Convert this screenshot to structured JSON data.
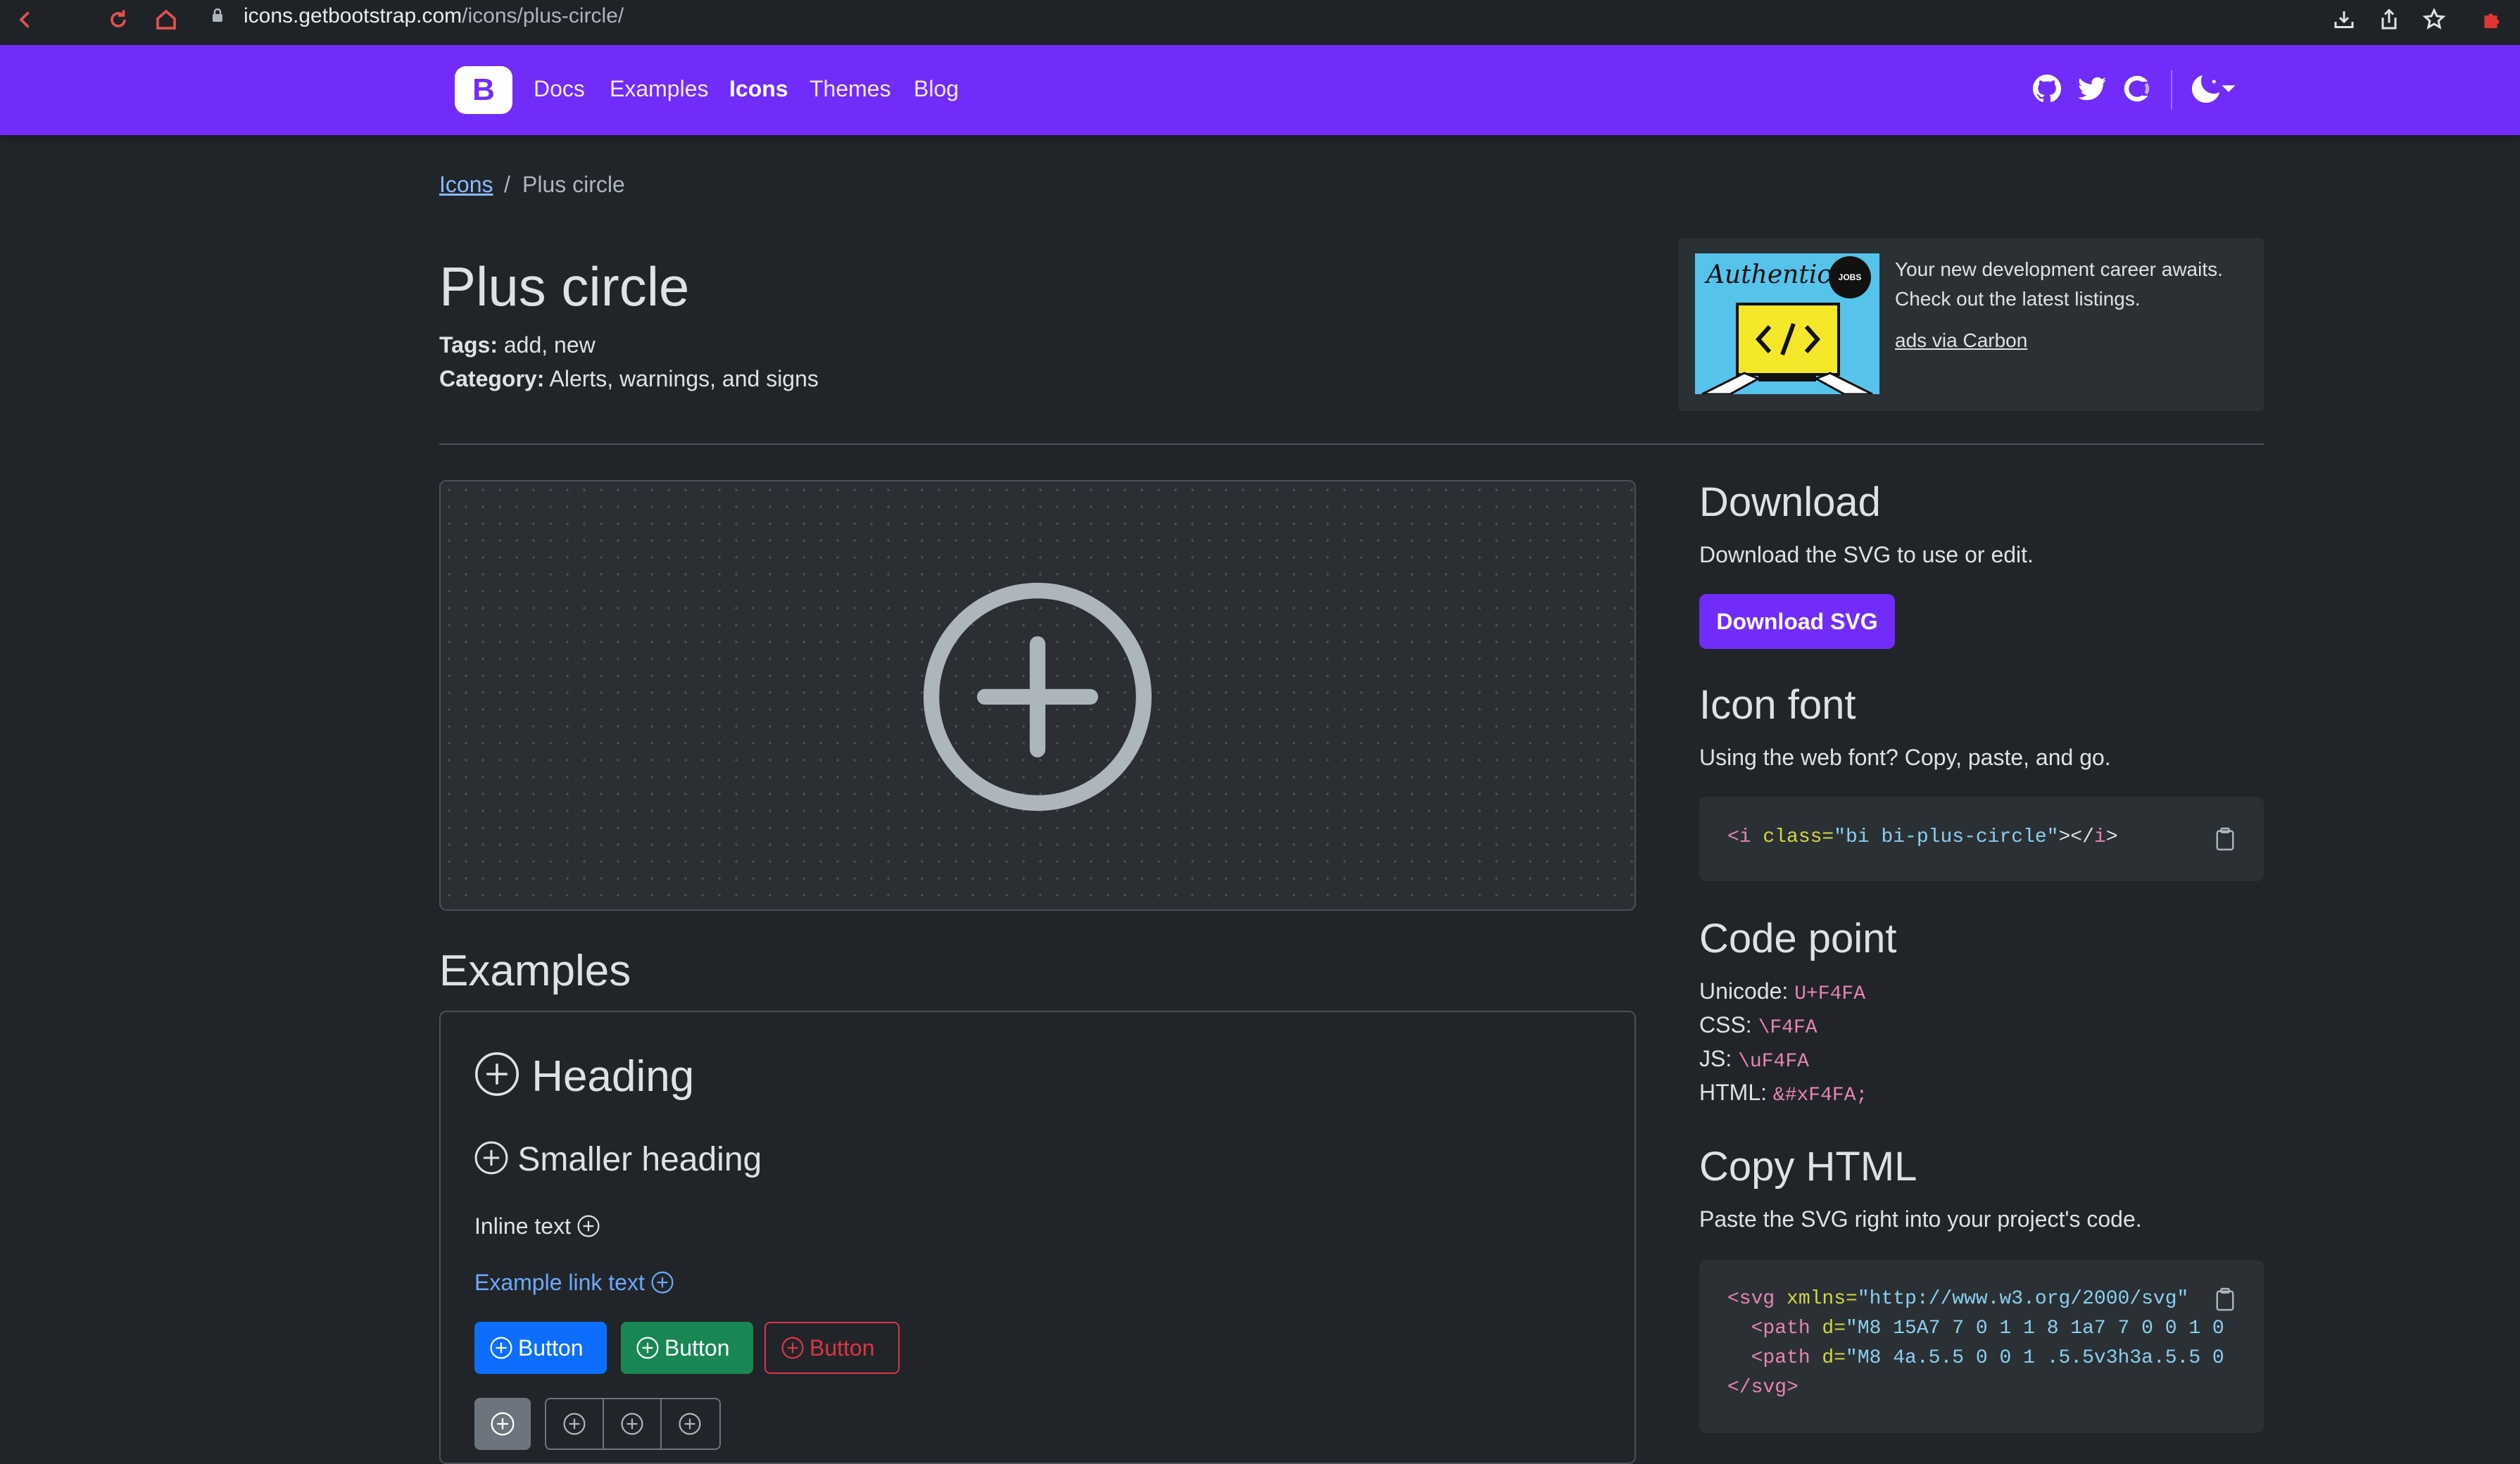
{
  "browser": {
    "url_host": "icons.getbootstrap.com",
    "url_path": "/icons/plus-circle/"
  },
  "navbar": {
    "brand": "B",
    "links": [
      "Docs",
      "Examples",
      "Icons",
      "Themes",
      "Blog"
    ],
    "active": "Icons"
  },
  "breadcrumb": {
    "parent": "Icons",
    "separator": "/",
    "current": "Plus circle"
  },
  "page": {
    "title": "Plus circle",
    "tags_label": "Tags:",
    "tags": "add, new",
    "category_label": "Category:",
    "category": "Alerts, warnings, and signs"
  },
  "ad": {
    "image_text": "Authentic",
    "badge": "JOBS",
    "text": "Your new development career awaits. Check out the latest listings.",
    "link": "ads via Carbon"
  },
  "download": {
    "heading": "Download",
    "description": "Download the SVG to use or edit.",
    "button": "Download SVG"
  },
  "icon_font": {
    "heading": "Icon font",
    "description": "Using the web font? Copy, paste, and go.",
    "code": {
      "open": "<i",
      "attr": " class=",
      "value": "\"bi bi-plus-circle\"",
      "close1": "></",
      "tag": "i",
      "close2": ">"
    }
  },
  "code_point": {
    "heading": "Code point",
    "rows": [
      {
        "label": "Unicode:",
        "value": "U+F4FA"
      },
      {
        "label": "CSS:",
        "value": "\\F4FA"
      },
      {
        "label": "JS:",
        "value": "\\uF4FA"
      },
      {
        "label": "HTML:",
        "value": "&#xF4FA;"
      }
    ]
  },
  "copy_html": {
    "heading": "Copy HTML",
    "description": "Paste the SVG right into your project's code.",
    "lines": [
      {
        "a": "<svg",
        "b": " xmlns=",
        "c": "\"http://www.w3.org/2000/svg\"",
        "d": ""
      },
      {
        "a": "  <path",
        "b": " d=",
        "c": "\"M8 15A7 7 0 1 1 8 1a7 7 0 0 1 0",
        "d": ""
      },
      {
        "a": "  <path",
        "b": " d=",
        "c": "\"M8 4a.5.5 0 0 1 .5.5v3h3a.5.5 0",
        "d": ""
      },
      {
        "a": "</svg>",
        "b": "",
        "c": "",
        "d": ""
      }
    ]
  },
  "examples": {
    "heading": "Examples",
    "h1": "Heading",
    "h2": "Smaller heading",
    "inline": "Inline text",
    "link": "Example link text",
    "buttons": [
      "Button",
      "Button",
      "Button"
    ]
  },
  "colors": {
    "navbar": "#712cf9",
    "background": "#212529",
    "link": "#6ea8fe",
    "code_pink": "#e685b5"
  },
  "icons": [
    "lock-icon",
    "github-icon",
    "twitter-icon",
    "open-collective-icon",
    "moon-icon",
    "chevron-down-icon",
    "clipboard-icon",
    "plus-circle-icon",
    "download-tray-icon",
    "share-icon",
    "star-icon",
    "puzzle-icon"
  ]
}
